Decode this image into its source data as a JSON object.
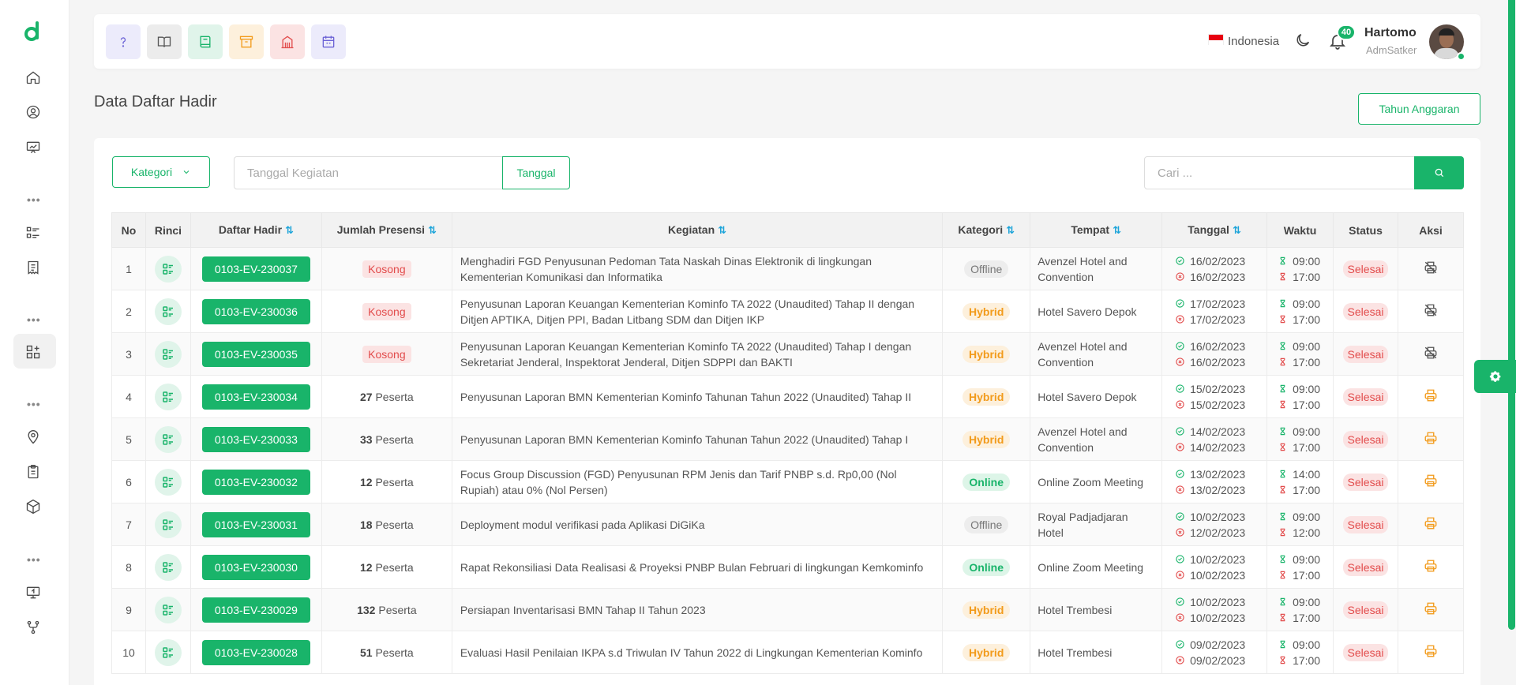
{
  "header": {
    "language": "Indonesia",
    "notification_count": "40",
    "user_name": "Hartomo",
    "user_role": "AdmSatker",
    "quick_buttons": [
      {
        "icon": "help-icon",
        "bg": "#ecebfb",
        "color": "#6c63d6"
      },
      {
        "icon": "book-open-icon",
        "bg": "#ececec",
        "color": "#555555"
      },
      {
        "icon": "book-icon",
        "bg": "#e0f4ea",
        "color": "#19b46a"
      },
      {
        "icon": "archive-icon",
        "bg": "#fdf0dc",
        "color": "#f29b1b"
      },
      {
        "icon": "building-icon",
        "bg": "#fbe3e3",
        "color": "#e24c4c"
      },
      {
        "icon": "calendar-icon",
        "bg": "#ecebfb",
        "color": "#6c63d6"
      }
    ]
  },
  "page": {
    "title": "Data Daftar Hadir",
    "tahun_anggaran_label": "Tahun Anggaran"
  },
  "filters": {
    "kategori_label": "Kategori",
    "tanggal_placeholder": "Tanggal Kegiatan",
    "tanggal_button": "Tanggal",
    "search_placeholder": "Cari ..."
  },
  "table": {
    "headers": {
      "no": "No",
      "rinci": "Rinci",
      "daftar_hadir": "Daftar Hadir",
      "jumlah_presensi": "Jumlah Presensi",
      "kegiatan": "Kegiatan",
      "kategori": "Kategori",
      "tempat": "Tempat",
      "tanggal": "Tanggal",
      "waktu": "Waktu",
      "status": "Status",
      "aksi": "Aksi"
    },
    "rows": [
      {
        "no": "1",
        "kode": "0103-EV-230037",
        "presensi_count": "",
        "presensi_label": "Kosong",
        "kegiatan": "Menghadiri FGD Penyusunan Pedoman Tata Naskah Dinas Elektronik di lingkungan Kementerian Komunikasi dan Informatika",
        "kategori": "Offline",
        "tempat": "Avenzel Hotel and Convention",
        "tgl_mulai": "16/02/2023",
        "tgl_selesai": "16/02/2023",
        "jam_mulai": "09:00",
        "jam_selesai": "17:00",
        "status": "Selesai",
        "aksi": "print-disabled-icon"
      },
      {
        "no": "2",
        "kode": "0103-EV-230036",
        "presensi_count": "",
        "presensi_label": "Kosong",
        "kegiatan": "Penyusunan Laporan Keuangan Kementerian Kominfo TA 2022 (Unaudited) Tahap II dengan Ditjen APTIKA, Ditjen PPI, Badan Litbang SDM dan Ditjen IKP",
        "kategori": "Hybrid",
        "tempat": "Hotel Savero Depok",
        "tgl_mulai": "17/02/2023",
        "tgl_selesai": "17/02/2023",
        "jam_mulai": "09:00",
        "jam_selesai": "17:00",
        "status": "Selesai",
        "aksi": "print-disabled-icon"
      },
      {
        "no": "3",
        "kode": "0103-EV-230035",
        "presensi_count": "",
        "presensi_label": "Kosong",
        "kegiatan": "Penyusunan Laporan Keuangan Kementerian Kominfo TA 2022 (Unaudited) Tahap I dengan Sekretariat Jenderal, Inspektorat Jenderal, Ditjen SDPPI dan BAKTI",
        "kategori": "Hybrid",
        "tempat": "Avenzel Hotel and Convention",
        "tgl_mulai": "16/02/2023",
        "tgl_selesai": "16/02/2023",
        "jam_mulai": "09:00",
        "jam_selesai": "17:00",
        "status": "Selesai",
        "aksi": "print-disabled-icon"
      },
      {
        "no": "4",
        "kode": "0103-EV-230034",
        "presensi_count": "27",
        "presensi_label": "Peserta",
        "kegiatan": "Penyusunan Laporan BMN Kementerian Kominfo Tahunan Tahun 2022 (Unaudited) Tahap II",
        "kategori": "Hybrid",
        "tempat": "Hotel Savero Depok",
        "tgl_mulai": "15/02/2023",
        "tgl_selesai": "15/02/2023",
        "jam_mulai": "09:00",
        "jam_selesai": "17:00",
        "status": "Selesai",
        "aksi": "print-icon"
      },
      {
        "no": "5",
        "kode": "0103-EV-230033",
        "presensi_count": "33",
        "presensi_label": "Peserta",
        "kegiatan": "Penyusunan Laporan BMN Kementerian Kominfo Tahunan Tahun 2022 (Unaudited) Tahap I",
        "kategori": "Hybrid",
        "tempat": "Avenzel Hotel and Convention",
        "tgl_mulai": "14/02/2023",
        "tgl_selesai": "14/02/2023",
        "jam_mulai": "09:00",
        "jam_selesai": "17:00",
        "status": "Selesai",
        "aksi": "print-icon"
      },
      {
        "no": "6",
        "kode": "0103-EV-230032",
        "presensi_count": "12",
        "presensi_label": "Peserta",
        "kegiatan": "Focus Group Discussion (FGD) Penyusunan RPM Jenis dan Tarif PNBP s.d. Rp0,00 (Nol Rupiah) atau 0% (Nol Persen)",
        "kategori": "Online",
        "tempat": "Online Zoom Meeting",
        "tgl_mulai": "13/02/2023",
        "tgl_selesai": "13/02/2023",
        "jam_mulai": "14:00",
        "jam_selesai": "17:00",
        "status": "Selesai",
        "aksi": "print-icon"
      },
      {
        "no": "7",
        "kode": "0103-EV-230031",
        "presensi_count": "18",
        "presensi_label": "Peserta",
        "kegiatan": "Deployment modul verifikasi pada Aplikasi DiGiKa",
        "kategori": "Offline",
        "tempat": "Royal Padjadjaran Hotel",
        "tgl_mulai": "10/02/2023",
        "tgl_selesai": "12/02/2023",
        "jam_mulai": "09:00",
        "jam_selesai": "12:00",
        "status": "Selesai",
        "aksi": "print-icon"
      },
      {
        "no": "8",
        "kode": "0103-EV-230030",
        "presensi_count": "12",
        "presensi_label": "Peserta",
        "kegiatan": "Rapat Rekonsiliasi Data Realisasi & Proyeksi PNBP Bulan Februari di lingkungan Kemkominfo",
        "kategori": "Online",
        "tempat": "Online Zoom Meeting",
        "tgl_mulai": "10/02/2023",
        "tgl_selesai": "10/02/2023",
        "jam_mulai": "09:00",
        "jam_selesai": "17:00",
        "status": "Selesai",
        "aksi": "print-icon"
      },
      {
        "no": "9",
        "kode": "0103-EV-230029",
        "presensi_count": "132",
        "presensi_label": "Peserta",
        "kegiatan": "Persiapan Inventarisasi BMN Tahap II Tahun 2023",
        "kategori": "Hybrid",
        "tempat": "Hotel Trembesi",
        "tgl_mulai": "10/02/2023",
        "tgl_selesai": "10/02/2023",
        "jam_mulai": "09:00",
        "jam_selesai": "17:00",
        "status": "Selesai",
        "aksi": "print-icon"
      },
      {
        "no": "10",
        "kode": "0103-EV-230028",
        "presensi_count": "51",
        "presensi_label": "Peserta",
        "kegiatan": "Evaluasi Hasil Penilaian IKPA s.d Triwulan IV Tahun 2022 di Lingkungan Kementerian Kominfo",
        "kategori": "Hybrid",
        "tempat": "Hotel Trembesi",
        "tgl_mulai": "09/02/2023",
        "tgl_selesai": "09/02/2023",
        "jam_mulai": "09:00",
        "jam_selesai": "17:00",
        "status": "Selesai",
        "aksi": "print-icon"
      }
    ]
  },
  "colors": {
    "primary": "#19b46a",
    "danger": "#e24c4c",
    "warning": "#f29b1b",
    "sort_arrow": "#1aa3d9"
  }
}
